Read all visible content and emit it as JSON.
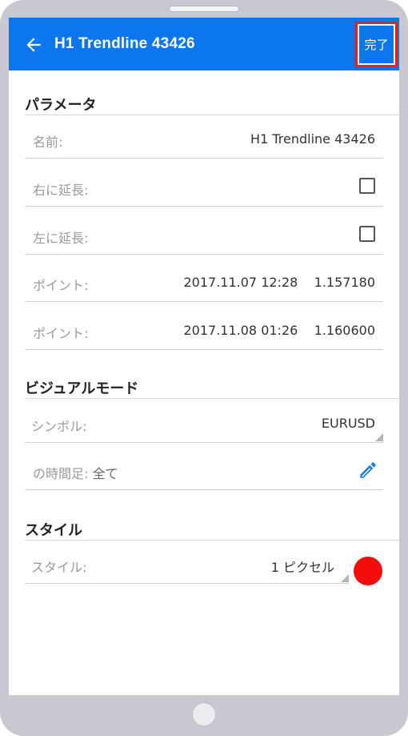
{
  "header": {
    "title": "H1 Trendline 43426",
    "done_label": "完了"
  },
  "parameters": {
    "title": "パラメータ",
    "name_label": "名前:",
    "name_value": "H1 Trendline 43426",
    "extend_right_label": "右に延長:",
    "extend_right_checked": false,
    "extend_left_label": "左に延長:",
    "extend_left_checked": false,
    "points": [
      {
        "label": "ポイント:",
        "datetime": "2017.11.07 12:28",
        "price": "1.157180"
      },
      {
        "label": "ポイント:",
        "datetime": "2017.11.08 01:26",
        "price": "1.160600"
      }
    ]
  },
  "visual_mode": {
    "title": "ビジュアルモード",
    "symbol_label": "シンボル:",
    "symbol_value": "EURUSD",
    "timeframe_label": "の時間足:",
    "timeframe_value": "全て"
  },
  "style": {
    "title": "スタイル",
    "style_label": "スタイル:",
    "style_value": "1 ピクセル",
    "color": "#f50c0c"
  },
  "theme": {
    "accent": "#0b76ed",
    "highlight_outline": "#e0231c"
  }
}
